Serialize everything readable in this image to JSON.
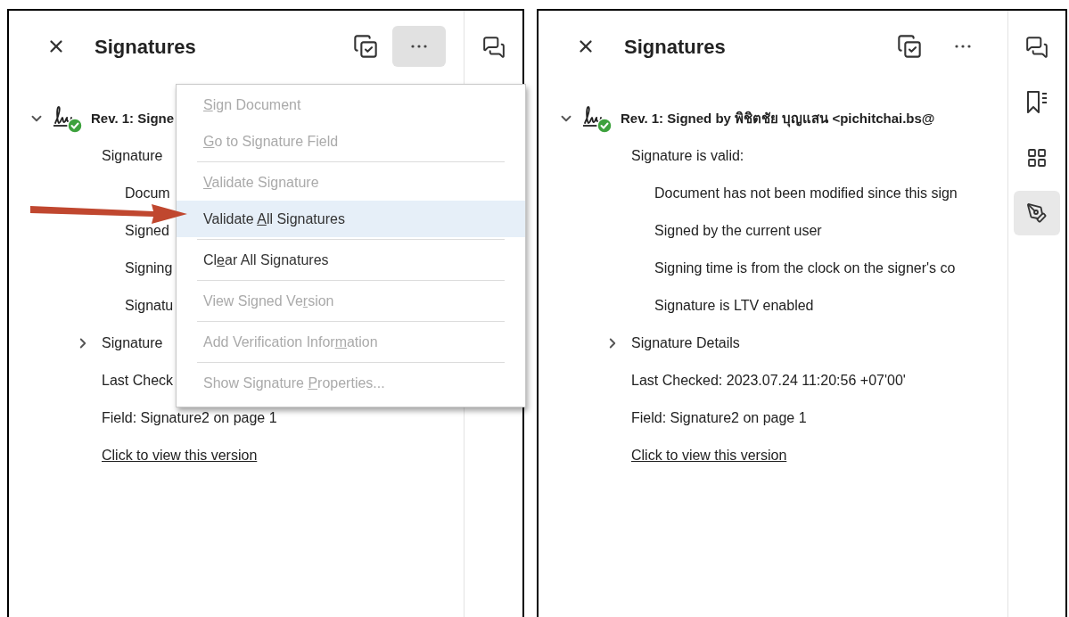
{
  "panels": [
    {
      "title": "Signatures",
      "more_pressed": true,
      "rail": [
        {
          "kind": "comments",
          "selected": false
        }
      ],
      "tree": [
        {
          "kind": "revision",
          "label": "Rev. 1: Signe",
          "valid": true,
          "expanded": true,
          "children": [
            {
              "kind": "text",
              "label": "Signature",
              "children": [
                {
                  "kind": "text",
                  "label": "Docum"
                },
                {
                  "kind": "text",
                  "label": "Signed"
                },
                {
                  "kind": "text",
                  "label": "Signing"
                },
                {
                  "kind": "text",
                  "label": "Signatu"
                }
              ]
            },
            {
              "kind": "text",
              "label": "Signature",
              "expanded": false
            },
            {
              "kind": "text",
              "label": "Last Check"
            },
            {
              "kind": "text",
              "label": "Field: Signature2 on page 1"
            },
            {
              "kind": "link",
              "label": "Click to view this version"
            }
          ]
        }
      ],
      "menu": {
        "groups": [
          [
            {
              "key": "S",
              "after": "ign Document",
              "disabled": true,
              "selected": false
            },
            {
              "key": "G",
              "after": "o to Signature Field",
              "disabled": true,
              "selected": false
            }
          ],
          [
            {
              "key": "V",
              "after": "alidate Signature",
              "disabled": true,
              "selected": false
            },
            {
              "before": "Validate ",
              "key": "A",
              "after": "ll Signatures",
              "disabled": false,
              "selected": true
            }
          ],
          [
            {
              "before": "Cl",
              "key": "e",
              "after": "ar All Signatures",
              "disabled": false,
              "selected": false
            }
          ],
          [
            {
              "before": "View Signed Ve",
              "key": "r",
              "after": "sion",
              "disabled": true,
              "selected": false
            }
          ],
          [
            {
              "before": "Add Verification Infor",
              "key": "m",
              "after": "ation",
              "disabled": true,
              "selected": false
            }
          ],
          [
            {
              "before": "Show Signature ",
              "key": "P",
              "after": "roperties...",
              "disabled": true,
              "selected": false
            }
          ]
        ]
      }
    },
    {
      "title": "Signatures",
      "more_pressed": false,
      "rail": [
        {
          "kind": "comments",
          "selected": false
        },
        {
          "kind": "bookmarks",
          "selected": false
        },
        {
          "kind": "thumbnails",
          "selected": false
        },
        {
          "kind": "signatures",
          "selected": true
        }
      ],
      "tree": [
        {
          "kind": "revision",
          "label": "Rev. 1: Signed by พิชิตชัย บุญแสน <pichitchai.bs@",
          "valid": true,
          "expanded": true,
          "children": [
            {
              "kind": "text",
              "label": "Signature is valid:",
              "children": [
                {
                  "kind": "text",
                  "label": "Document has not been modified since this sign"
                },
                {
                  "kind": "text",
                  "label": "Signed by the current user"
                },
                {
                  "kind": "text",
                  "label": "Signing time is from the clock on the signer's co"
                },
                {
                  "kind": "text",
                  "label": "Signature is LTV enabled"
                }
              ]
            },
            {
              "kind": "text",
              "label": "Signature Details",
              "expanded": false
            },
            {
              "kind": "text",
              "label": "Last Checked: 2023.07.24 11:20:56 +07'00'"
            },
            {
              "kind": "text",
              "label": "Field: Signature2 on page 1"
            },
            {
              "kind": "link",
              "label": "Click to view this version"
            }
          ]
        }
      ]
    }
  ]
}
